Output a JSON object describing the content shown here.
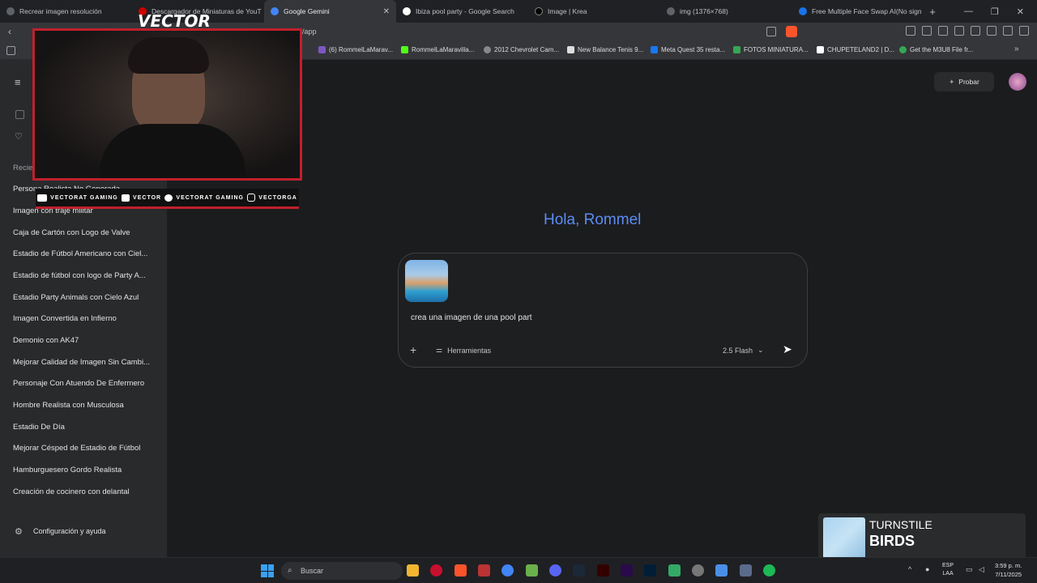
{
  "tabs": [
    {
      "label": "Recrear imagen resolución"
    },
    {
      "label": "Descargador de Miniaturas de YouT"
    },
    {
      "label": "Google Gemini"
    },
    {
      "label": "Ibiza pool party - Google Search"
    },
    {
      "label": "Image | Krea"
    },
    {
      "label": "img (1376×768)"
    },
    {
      "label": "Free Multiple Face Swap AI(No sign"
    }
  ],
  "address": {
    "url": "/app"
  },
  "bookmarks": [
    {
      "label": "(6) RommelLaMarav..."
    },
    {
      "label": "RommelLaMaravilla..."
    },
    {
      "label": "2012 Chevrolet Cam..."
    },
    {
      "label": "New Balance Tenis 9..."
    },
    {
      "label": "Meta Quest 35 resta..."
    },
    {
      "label": "FOTOS MINIATURA..."
    },
    {
      "label": "CHUPETELAND2 | D..."
    },
    {
      "label": "Get the M3U8 File fr..."
    }
  ],
  "overlay": {
    "logo": "VECTOR",
    "socials": [
      {
        "label": "VECTORAT GAMING"
      },
      {
        "label": "VECTOR"
      },
      {
        "label": "VECTORAT GAMING"
      },
      {
        "label": "VECTORGA"
      }
    ]
  },
  "sidebar": {
    "recent_heading": "Recie",
    "items": [
      {
        "label": "Persona Realista No Generada"
      },
      {
        "label": "Imagen con traje militar"
      },
      {
        "label": "Caja de Cartón con Logo de Valve"
      },
      {
        "label": "Estadio de Fútbol Americano con Ciel..."
      },
      {
        "label": "Estadio de fútbol con logo de Party A..."
      },
      {
        "label": "Estadio Party Animals con Cielo Azul"
      },
      {
        "label": "Imagen Convertida en Infierno"
      },
      {
        "label": "Demonio con AK47"
      },
      {
        "label": "Mejorar Calidad de Imagen Sin Cambi..."
      },
      {
        "label": "Personaje Con Atuendo De Enfermero"
      },
      {
        "label": "Hombre Realista con Musculosa"
      },
      {
        "label": "Estadio De Día"
      },
      {
        "label": "Mejorar Césped de Estadio de Fútbol"
      },
      {
        "label": "Hamburguesero Gordo Realista"
      },
      {
        "label": "Creación de cocinero con delantal"
      }
    ],
    "settings": "Configuración y ayuda"
  },
  "header": {
    "try_button": "Probar"
  },
  "main": {
    "greeting": "Hola, Rommel",
    "prompt_text": "crea una imagen de una pool part",
    "tools_label": "Herramientas",
    "model_label": "2.5 Flash"
  },
  "now_playing": {
    "title": "TURNSTILE",
    "artist": "BIRDS"
  },
  "taskbar": {
    "search_placeholder": "Buscar",
    "lang_line1": "ESP",
    "lang_line2": "LAA",
    "time": "3:59 p. m.",
    "date": "7/11/2025"
  },
  "colors": {
    "accent_red": "#c0202c",
    "greeting_blue": "#5b8cf5",
    "spotify_green": "#1db954"
  }
}
